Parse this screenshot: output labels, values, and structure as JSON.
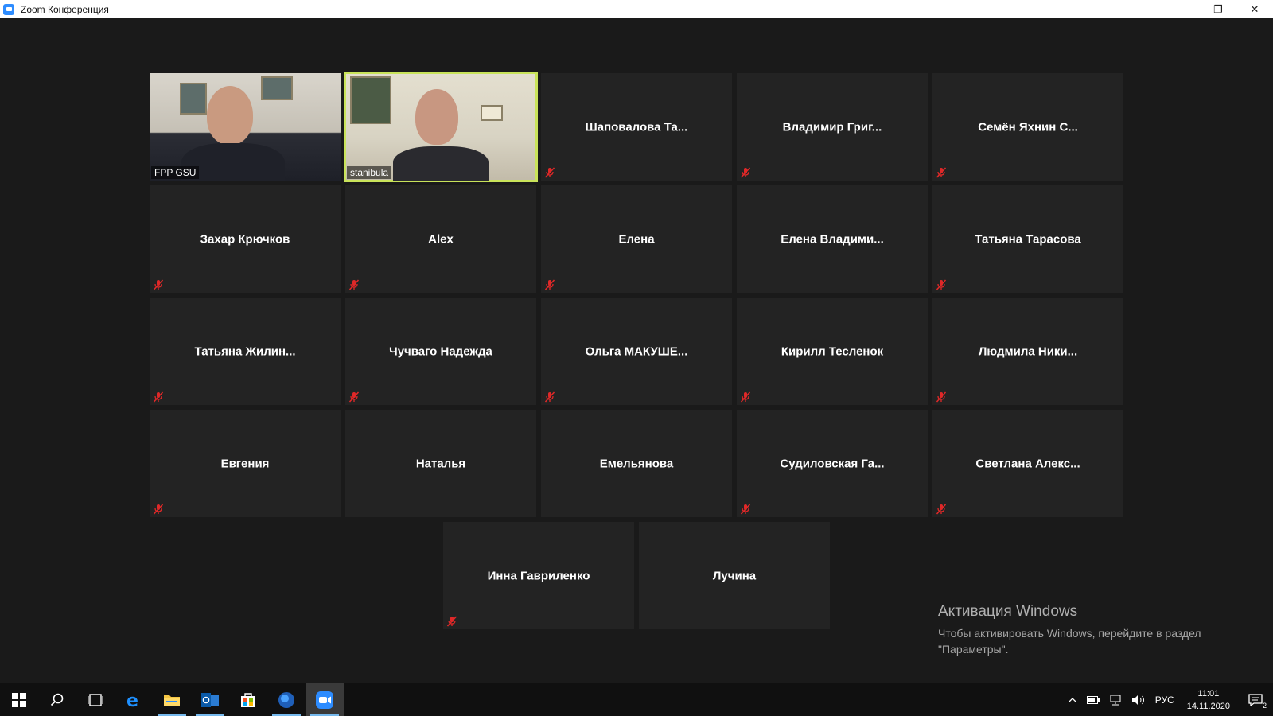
{
  "window": {
    "title": "Zoom Конференция",
    "controls": {
      "minimize": "—",
      "restore": "❐",
      "close": "✕"
    }
  },
  "meeting": {
    "rows": [
      [
        {
          "name": "FPP GSU",
          "video": true,
          "active": false,
          "muted": false
        },
        {
          "name": "stanibula",
          "video": true,
          "active": true,
          "muted": false
        },
        {
          "name": "Шаповалова  Та...",
          "video": false,
          "muted": true
        },
        {
          "name": "Владимир  Григ...",
          "video": false,
          "muted": true
        },
        {
          "name": "Семён Яхнин С...",
          "video": false,
          "muted": true
        }
      ],
      [
        {
          "name": "Захар Крючков",
          "video": false,
          "muted": true
        },
        {
          "name": "Alex",
          "video": false,
          "muted": true
        },
        {
          "name": "Елена",
          "video": false,
          "muted": true
        },
        {
          "name": "Елена  Владими...",
          "video": false,
          "muted": false
        },
        {
          "name": "Татьяна Тарасова",
          "video": false,
          "muted": true
        }
      ],
      [
        {
          "name": "Татьяна  Жилин...",
          "video": false,
          "muted": true
        },
        {
          "name": "Чучваго Надежда",
          "video": false,
          "muted": true
        },
        {
          "name": "Ольга  МАКУШЕ...",
          "video": false,
          "muted": true
        },
        {
          "name": "Кирилл Тесленок",
          "video": false,
          "muted": true
        },
        {
          "name": "Людмила  Ники...",
          "video": false,
          "muted": true
        }
      ],
      [
        {
          "name": "Евгения",
          "video": false,
          "muted": true
        },
        {
          "name": "Наталья",
          "video": false,
          "muted": false
        },
        {
          "name": "Емельянова",
          "video": false,
          "muted": false
        },
        {
          "name": "Судиловская  Га...",
          "video": false,
          "muted": true
        },
        {
          "name": "Светлана  Алекс...",
          "video": false,
          "muted": true
        }
      ],
      [
        {
          "name": "Инна Гавриленко",
          "video": false,
          "muted": true
        },
        {
          "name": "Лучина",
          "video": false,
          "muted": false
        }
      ]
    ]
  },
  "activation": {
    "title": "Активация Windows",
    "line1": "Чтобы активировать Windows, перейдите в раздел",
    "line2": "\"Параметры\"."
  },
  "taskbar": {
    "apps": [
      "start-icon",
      "search-icon",
      "task-view-icon",
      "edge-icon",
      "file-explorer-icon",
      "outlook-icon",
      "store-icon",
      "browser-icon",
      "zoom-icon"
    ],
    "tray": {
      "language": "РУС",
      "time": "11:01",
      "date": "14.11.2020",
      "notifications": "2"
    }
  },
  "colors": {
    "background": "#1a1a1a",
    "tile": "#232323",
    "active_speaker": "#c9e35a",
    "muted_icon": "#e02828",
    "zoom_blue": "#2d8cff"
  }
}
